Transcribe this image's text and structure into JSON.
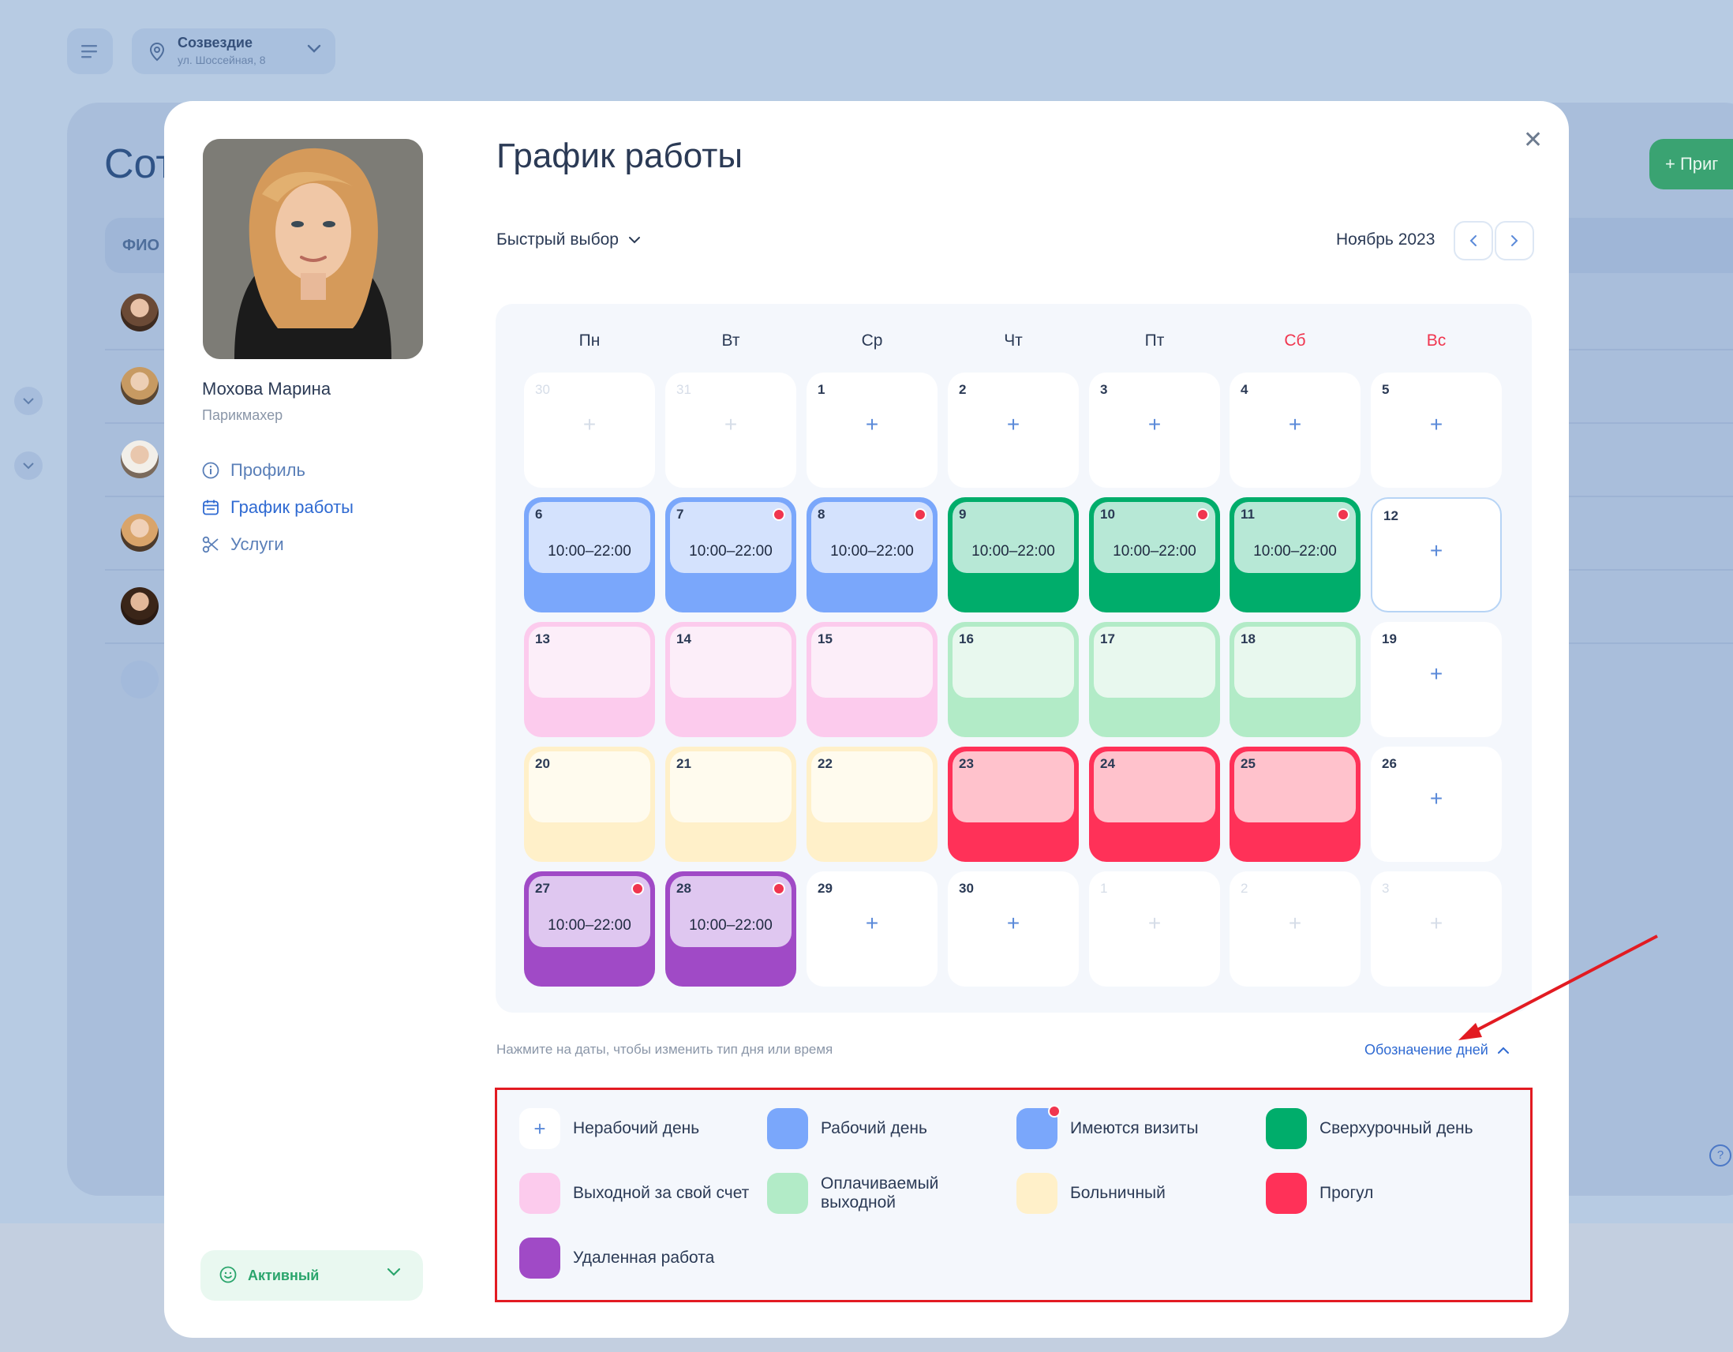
{
  "topbar": {
    "location_name": "Созвездие",
    "location_address": "ул. Шоссейная, 8"
  },
  "background": {
    "title": "Сот",
    "table_header": "ФИО",
    "invite_label": "+ Приг",
    "help_label": "?"
  },
  "employee": {
    "name": "Мохова Марина",
    "role": "Парикмахер",
    "nav": [
      {
        "label": "Профиль",
        "icon": "info-icon"
      },
      {
        "label": "График работы",
        "icon": "calendar-icon"
      },
      {
        "label": "Услуги",
        "icon": "scissors-icon"
      }
    ],
    "status": "Активный"
  },
  "schedule": {
    "title": "График работы",
    "quick_select": "Быстрый выбор",
    "month": "Ноябрь 2023",
    "weekdays": [
      "Пн",
      "Вт",
      "Ср",
      "Чт",
      "Пт",
      "Сб",
      "Вс"
    ],
    "weeks": [
      [
        {
          "n": "30",
          "type": "muted"
        },
        {
          "n": "31",
          "type": "muted"
        },
        {
          "n": "1",
          "type": "off"
        },
        {
          "n": "2",
          "type": "off"
        },
        {
          "n": "3",
          "type": "off"
        },
        {
          "n": "4",
          "type": "off"
        },
        {
          "n": "5",
          "type": "off"
        }
      ],
      [
        {
          "n": "6",
          "type": "work",
          "time": "10:00–22:00"
        },
        {
          "n": "7",
          "type": "work",
          "time": "10:00–22:00",
          "visits": true
        },
        {
          "n": "8",
          "type": "work",
          "time": "10:00–22:00",
          "visits": true
        },
        {
          "n": "9",
          "type": "overtime",
          "time": "10:00–22:00"
        },
        {
          "n": "10",
          "type": "overtime",
          "time": "10:00–22:00",
          "visits": true
        },
        {
          "n": "11",
          "type": "overtime",
          "time": "10:00–22:00",
          "visits": true
        },
        {
          "n": "12",
          "type": "off",
          "selected": true
        }
      ],
      [
        {
          "n": "13",
          "type": "unpaid"
        },
        {
          "n": "14",
          "type": "unpaid"
        },
        {
          "n": "15",
          "type": "unpaid"
        },
        {
          "n": "16",
          "type": "paid"
        },
        {
          "n": "17",
          "type": "paid"
        },
        {
          "n": "18",
          "type": "paid"
        },
        {
          "n": "19",
          "type": "off"
        }
      ],
      [
        {
          "n": "20",
          "type": "sick"
        },
        {
          "n": "21",
          "type": "sick"
        },
        {
          "n": "22",
          "type": "sick"
        },
        {
          "n": "23",
          "type": "absent"
        },
        {
          "n": "24",
          "type": "absent"
        },
        {
          "n": "25",
          "type": "absent"
        },
        {
          "n": "26",
          "type": "off"
        }
      ],
      [
        {
          "n": "27",
          "type": "remote",
          "time": "10:00–22:00",
          "visits": true
        },
        {
          "n": "28",
          "type": "remote",
          "time": "10:00–22:00",
          "visits": true
        },
        {
          "n": "29",
          "type": "off"
        },
        {
          "n": "30",
          "type": "off"
        },
        {
          "n": "1",
          "type": "muted"
        },
        {
          "n": "2",
          "type": "muted"
        },
        {
          "n": "3",
          "type": "muted"
        }
      ]
    ],
    "hint": "Нажмите на даты, чтобы изменить тип дня или время",
    "legend_toggle": "Обозначение дней"
  },
  "day_types": {
    "off": {
      "outer": "#ffffff",
      "inner": "#ffffff"
    },
    "muted": {
      "outer": "#ffffff",
      "inner": "#ffffff"
    },
    "work": {
      "outer": "#7aa7fb",
      "inner": "#d4e2fd"
    },
    "overtime": {
      "outer": "#00ad6b",
      "inner": "#b7e8d6"
    },
    "unpaid": {
      "outer": "#fccbed",
      "inner": "#fceef9"
    },
    "paid": {
      "outer": "#b2ebc7",
      "inner": "#e8f8ee"
    },
    "sick": {
      "outer": "#fff0c9",
      "inner": "#fffbee"
    },
    "absent": {
      "outer": "#ff3158",
      "inner": "#ffc2cc"
    },
    "remote": {
      "outer": "#a04ac6",
      "inner": "#dfc7f0"
    }
  },
  "legend": [
    {
      "label": "Нерабочий день",
      "swatch": "plus"
    },
    {
      "label": "Рабочий день",
      "color": "#7aa7fb"
    },
    {
      "label": "Имеются визиты",
      "color": "#7aa7fb",
      "dot": true
    },
    {
      "label": "Сверхурочный день",
      "color": "#00ad6b"
    },
    {
      "label": "Выходной за свой счет",
      "color": "#fccbed"
    },
    {
      "label": "Оплачиваемый выходной",
      "color": "#b2ebc7"
    },
    {
      "label": "Больничный",
      "color": "#fff0c9"
    },
    {
      "label": "Прогул",
      "color": "#ff3158"
    },
    {
      "label": "Удаленная работа",
      "color": "#a04ac6"
    }
  ]
}
